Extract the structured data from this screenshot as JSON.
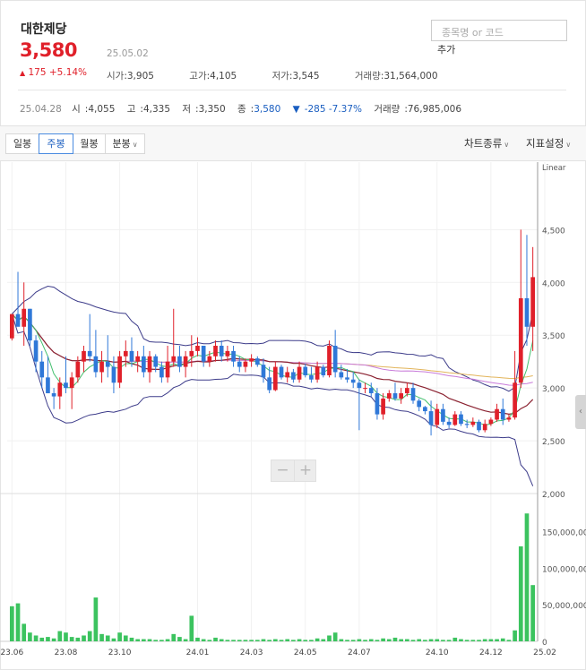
{
  "stock": {
    "name": "대한제당",
    "price": "3,580",
    "change": "175 +5.14%",
    "change_arrow": "▲",
    "date": "25.05.02",
    "open_label": "시가",
    "open": "3,905",
    "high_label": "고가",
    "high": "4,105",
    "low_label": "저가",
    "low": "3,545",
    "volume_label": "거래량",
    "volume": "31,564,000"
  },
  "search": {
    "placeholder": "종목명 or 코드",
    "add_label": "추가"
  },
  "week": {
    "date": "25.04.28",
    "open_label": "시",
    "open": "4,055",
    "high_label": "고",
    "high": "4,335",
    "low_label": "저",
    "low": "3,350",
    "close_label": "종",
    "close": "3,580",
    "change_arrow": "▼",
    "change": "-285 -7.37%",
    "volume_label": "거래량",
    "volume": "76,985,006"
  },
  "toolbar": {
    "daily": "일봉",
    "weekly": "주봉",
    "monthly": "월봉",
    "minute": "분봉",
    "chart_type": "차트종류",
    "indicator": "지표설정"
  },
  "zoom": {
    "minus": "−",
    "plus": "+"
  },
  "colors": {
    "up": "#e0202a",
    "down": "#2f78d8",
    "volume": "#3cc35f",
    "band": "#3d3c8a",
    "ma5": "#43c06e",
    "ma20": "#8b2231",
    "ma60": "#c87ad9",
    "ma120": "#e2b45a"
  },
  "chart_data": {
    "type": "candlestick",
    "scale_label": "Linear",
    "price_axis": {
      "ticks": [
        "4,500",
        "4,000",
        "3,500",
        "3,000",
        "2,500",
        "2,000"
      ],
      "range": [
        2000,
        4800
      ]
    },
    "volume_axis": {
      "ticks": [
        "150,000,000",
        "100,000,000",
        "50,000,000",
        "0"
      ],
      "range": [
        0,
        190000000
      ]
    },
    "x_ticks": [
      {
        "label": "23.06",
        "index": 0
      },
      {
        "label": "23.08",
        "index": 9
      },
      {
        "label": "23.10",
        "index": 18
      },
      {
        "label": "24.01",
        "index": 31
      },
      {
        "label": "24.03",
        "index": 40
      },
      {
        "label": "24.05",
        "index": 49
      },
      {
        "label": "24.07",
        "index": 58
      },
      {
        "label": "24.10",
        "index": 71
      },
      {
        "label": "24.12",
        "index": 80
      },
      {
        "label": "25.02",
        "index": 89
      }
    ],
    "candles": [
      {
        "o": 3470,
        "h": 3680,
        "l": 3450,
        "c": 3700,
        "v": 48000000
      },
      {
        "o": 3700,
        "h": 4100,
        "l": 3600,
        "c": 3580,
        "v": 52000000
      },
      {
        "o": 3580,
        "h": 4000,
        "l": 3400,
        "c": 3750,
        "v": 24000000
      },
      {
        "o": 3750,
        "h": 3750,
        "l": 3400,
        "c": 3450,
        "v": 12000000
      },
      {
        "o": 3450,
        "h": 3500,
        "l": 3150,
        "c": 3250,
        "v": 8000000
      },
      {
        "o": 3250,
        "h": 3350,
        "l": 3000,
        "c": 3100,
        "v": 5000000
      },
      {
        "o": 3100,
        "h": 3300,
        "l": 2950,
        "c": 2950,
        "v": 6000000
      },
      {
        "o": 2950,
        "h": 3000,
        "l": 2800,
        "c": 2920,
        "v": 4000000
      },
      {
        "o": 2920,
        "h": 3100,
        "l": 2800,
        "c": 3050,
        "v": 14000000
      },
      {
        "o": 3050,
        "h": 3300,
        "l": 2950,
        "c": 3000,
        "v": 12000000
      },
      {
        "o": 3000,
        "h": 3150,
        "l": 2800,
        "c": 3100,
        "v": 6000000
      },
      {
        "o": 3100,
        "h": 3300,
        "l": 3050,
        "c": 3250,
        "v": 5000000
      },
      {
        "o": 3250,
        "h": 3400,
        "l": 3150,
        "c": 3350,
        "v": 8000000
      },
      {
        "o": 3350,
        "h": 3700,
        "l": 3250,
        "c": 3300,
        "v": 14000000
      },
      {
        "o": 3300,
        "h": 3550,
        "l": 3100,
        "c": 3150,
        "v": 60000000
      },
      {
        "o": 3150,
        "h": 3350,
        "l": 3050,
        "c": 3250,
        "v": 10000000
      },
      {
        "o": 3250,
        "h": 3500,
        "l": 3100,
        "c": 3200,
        "v": 8000000
      },
      {
        "o": 3200,
        "h": 3300,
        "l": 2950,
        "c": 3050,
        "v": 4000000
      },
      {
        "o": 3050,
        "h": 3350,
        "l": 3000,
        "c": 3300,
        "v": 12000000
      },
      {
        "o": 3300,
        "h": 3450,
        "l": 3200,
        "c": 3350,
        "v": 8000000
      },
      {
        "o": 3350,
        "h": 3480,
        "l": 3200,
        "c": 3250,
        "v": 5000000
      },
      {
        "o": 3250,
        "h": 3350,
        "l": 3150,
        "c": 3300,
        "v": 3000000
      },
      {
        "o": 3300,
        "h": 3400,
        "l": 3100,
        "c": 3150,
        "v": 3000000
      },
      {
        "o": 3150,
        "h": 3350,
        "l": 3050,
        "c": 3300,
        "v": 3000000
      },
      {
        "o": 3300,
        "h": 3320,
        "l": 3150,
        "c": 3200,
        "v": 2000000
      },
      {
        "o": 3200,
        "h": 3250,
        "l": 3050,
        "c": 3100,
        "v": 2000000
      },
      {
        "o": 3100,
        "h": 3400,
        "l": 3050,
        "c": 3250,
        "v": 3000000
      },
      {
        "o": 3250,
        "h": 3750,
        "l": 3200,
        "c": 3300,
        "v": 10000000
      },
      {
        "o": 3300,
        "h": 3400,
        "l": 3150,
        "c": 3200,
        "v": 6000000
      },
      {
        "o": 3200,
        "h": 3350,
        "l": 3100,
        "c": 3300,
        "v": 3000000
      },
      {
        "o": 3300,
        "h": 3500,
        "l": 3200,
        "c": 3350,
        "v": 35000000
      },
      {
        "o": 3350,
        "h": 3480,
        "l": 3300,
        "c": 3400,
        "v": 5000000
      },
      {
        "o": 3400,
        "h": 3400,
        "l": 3200,
        "c": 3250,
        "v": 3000000
      },
      {
        "o": 3250,
        "h": 3350,
        "l": 3200,
        "c": 3300,
        "v": 2000000
      },
      {
        "o": 3300,
        "h": 3450,
        "l": 3250,
        "c": 3400,
        "v": 5000000
      },
      {
        "o": 3400,
        "h": 3450,
        "l": 3250,
        "c": 3300,
        "v": 3000000
      },
      {
        "o": 3300,
        "h": 3400,
        "l": 3250,
        "c": 3350,
        "v": 2000000
      },
      {
        "o": 3350,
        "h": 3400,
        "l": 3200,
        "c": 3250,
        "v": 2000000
      },
      {
        "o": 3250,
        "h": 3300,
        "l": 3150,
        "c": 3200,
        "v": 2000000
      },
      {
        "o": 3200,
        "h": 3280,
        "l": 3150,
        "c": 3250,
        "v": 2000000
      },
      {
        "o": 3250,
        "h": 3320,
        "l": 3200,
        "c": 3280,
        "v": 2000000
      },
      {
        "o": 3280,
        "h": 3300,
        "l": 3200,
        "c": 3220,
        "v": 2000000
      },
      {
        "o": 3220,
        "h": 3280,
        "l": 3050,
        "c": 3100,
        "v": 3000000
      },
      {
        "o": 3100,
        "h": 3200,
        "l": 2950,
        "c": 2980,
        "v": 2000000
      },
      {
        "o": 2980,
        "h": 3250,
        "l": 2970,
        "c": 3200,
        "v": 3000000
      },
      {
        "o": 3200,
        "h": 3220,
        "l": 3080,
        "c": 3100,
        "v": 2000000
      },
      {
        "o": 3100,
        "h": 3200,
        "l": 3050,
        "c": 3150,
        "v": 3000000
      },
      {
        "o": 3150,
        "h": 3180,
        "l": 3050,
        "c": 3080,
        "v": 2000000
      },
      {
        "o": 3080,
        "h": 3250,
        "l": 3050,
        "c": 3200,
        "v": 3000000
      },
      {
        "o": 3200,
        "h": 3230,
        "l": 3100,
        "c": 3120,
        "v": 2000000
      },
      {
        "o": 3120,
        "h": 3200,
        "l": 3050,
        "c": 3080,
        "v": 2000000
      },
      {
        "o": 3080,
        "h": 3250,
        "l": 3050,
        "c": 3200,
        "v": 4000000
      },
      {
        "o": 3200,
        "h": 3220,
        "l": 3100,
        "c": 3120,
        "v": 3000000
      },
      {
        "o": 3120,
        "h": 3450,
        "l": 3100,
        "c": 3400,
        "v": 8000000
      },
      {
        "o": 3400,
        "h": 3550,
        "l": 3100,
        "c": 3150,
        "v": 12000000
      },
      {
        "o": 3150,
        "h": 3220,
        "l": 3080,
        "c": 3100,
        "v": 3000000
      },
      {
        "o": 3100,
        "h": 3180,
        "l": 3050,
        "c": 3080,
        "v": 2000000
      },
      {
        "o": 3080,
        "h": 3150,
        "l": 3000,
        "c": 3050,
        "v": 2000000
      },
      {
        "o": 3050,
        "h": 3080,
        "l": 2600,
        "c": 3000,
        "v": 3000000
      },
      {
        "o": 3000,
        "h": 3050,
        "l": 2950,
        "c": 3000,
        "v": 2000000
      },
      {
        "o": 3000,
        "h": 3050,
        "l": 2920,
        "c": 2950,
        "v": 3000000
      },
      {
        "o": 2950,
        "h": 3000,
        "l": 2700,
        "c": 2750,
        "v": 2000000
      },
      {
        "o": 2750,
        "h": 2950,
        "l": 2700,
        "c": 2900,
        "v": 4000000
      },
      {
        "o": 2900,
        "h": 2980,
        "l": 2870,
        "c": 2950,
        "v": 3000000
      },
      {
        "o": 2950,
        "h": 3050,
        "l": 2880,
        "c": 2900,
        "v": 5000000
      },
      {
        "o": 2900,
        "h": 3000,
        "l": 2850,
        "c": 2950,
        "v": 3000000
      },
      {
        "o": 2950,
        "h": 3050,
        "l": 2920,
        "c": 3000,
        "v": 3000000
      },
      {
        "o": 3000,
        "h": 3050,
        "l": 2850,
        "c": 2880,
        "v": 2000000
      },
      {
        "o": 2880,
        "h": 2900,
        "l": 2780,
        "c": 2820,
        "v": 3000000
      },
      {
        "o": 2820,
        "h": 2830,
        "l": 2750,
        "c": 2780,
        "v": 2000000
      },
      {
        "o": 2780,
        "h": 2880,
        "l": 2550,
        "c": 2650,
        "v": 3000000
      },
      {
        "o": 2650,
        "h": 2850,
        "l": 2620,
        "c": 2800,
        "v": 3000000
      },
      {
        "o": 2800,
        "h": 2850,
        "l": 2650,
        "c": 2680,
        "v": 2000000
      },
      {
        "o": 2680,
        "h": 2720,
        "l": 2620,
        "c": 2650,
        "v": 2000000
      },
      {
        "o": 2650,
        "h": 2780,
        "l": 2640,
        "c": 2750,
        "v": 5000000
      },
      {
        "o": 2750,
        "h": 2780,
        "l": 2640,
        "c": 2660,
        "v": 3000000
      },
      {
        "o": 2660,
        "h": 2700,
        "l": 2620,
        "c": 2650,
        "v": 2000000
      },
      {
        "o": 2650,
        "h": 2720,
        "l": 2630,
        "c": 2680,
        "v": 2000000
      },
      {
        "o": 2680,
        "h": 2700,
        "l": 2580,
        "c": 2600,
        "v": 2000000
      },
      {
        "o": 2600,
        "h": 2700,
        "l": 2580,
        "c": 2660,
        "v": 3000000
      },
      {
        "o": 2660,
        "h": 2720,
        "l": 2640,
        "c": 2700,
        "v": 3000000
      },
      {
        "o": 2700,
        "h": 2850,
        "l": 2680,
        "c": 2800,
        "v": 3000000
      },
      {
        "o": 2800,
        "h": 2900,
        "l": 2650,
        "c": 2700,
        "v": 4000000
      },
      {
        "o": 2700,
        "h": 2750,
        "l": 2680,
        "c": 2720,
        "v": 2000000
      },
      {
        "o": 2720,
        "h": 3350,
        "l": 2700,
        "c": 3050,
        "v": 15000000
      },
      {
        "o": 3050,
        "h": 4500,
        "l": 3000,
        "c": 3850,
        "v": 130000000
      },
      {
        "o": 3850,
        "h": 4450,
        "l": 3400,
        "c": 3580,
        "v": 175000000
      },
      {
        "o": 3580,
        "h": 4335,
        "l": 3350,
        "c": 4050,
        "v": 77000000
      }
    ]
  }
}
